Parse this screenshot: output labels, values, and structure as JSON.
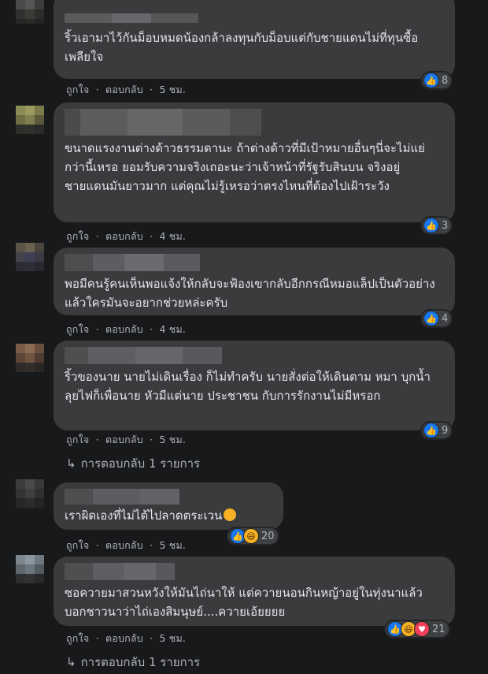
{
  "comments": [
    {
      "text": "ริ้วเอามาไว้กันม็อบหมดน้องกล้าลงทุนกับม็อบแต่กับชายแดนไม่ที่ทุนซื้อ เพลียใจ",
      "like_label": "ถูกใจ",
      "reply_label": "ตอบกลับ",
      "sep": "·",
      "time": "5 ชม.",
      "reactions": [
        "like"
      ],
      "reaction_count": "8"
    },
    {
      "text": "ขนาดแรงงานต่างด้าวธรรมดานะ ถ้าต่างด้าวที่มีเป้าหมายอื่นๆนี่จะไม่แย่กว่านี้เหรอ ยอมรับความจริงเถอะนะว่าเจ้าหน้าที่รัฐรับสินบน จริงอยู่ชายแดนมันยาวมาก แต่คุณไม่รู้เหรอว่าตรงไหนที่ต้องไปเฝ้าระวัง",
      "like_label": "ถูกใจ",
      "reply_label": "ตอบกลับ",
      "sep": "·",
      "time": "4 ชม.",
      "reactions": [
        "like"
      ],
      "reaction_count": "3"
    },
    {
      "text": "พอมีคนรู้คนเห็นพอแจ้งให้กลับจะฟ้องเขากลับอีกกรณีหมอแล็ปเป็นตัวอย่างแล้วใครมันจะอยากช่วยหล่ะครับ",
      "like_label": "ถูกใจ",
      "reply_label": "ตอบกลับ",
      "sep": "·",
      "time": "4 ชม.",
      "reactions": [
        "like"
      ],
      "reaction_count": "4"
    },
    {
      "text": "ริ้วของนาย นายไม่เดินเรื่อง ก็ไม่ทำครับ นายสั่งต่อให้เดินตาม หมา บุกน้ำลุยไฟก็เพื่อนาย หัวมีแต่นาย ประชาชน กับการรักงานไม่มีหรอก",
      "like_label": "ถูกใจ",
      "reply_label": "ตอบกลับ",
      "sep": "·",
      "time": "5 ชม.",
      "reactions": [
        "like"
      ],
      "reaction_count": "9",
      "replies_label": "การตอบกลับ 1 รายการ"
    },
    {
      "text": "เราผิดเองที่ไม่ได้ไปลาดตระเวน",
      "like_label": "ถูกใจ",
      "reply_label": "ตอบกลับ",
      "sep": "·",
      "time": "5 ชม.",
      "reactions": [
        "like",
        "haha"
      ],
      "reaction_count": "20"
    },
    {
      "text": "ซอควายมาสวนหวังให้มันไถ่นาให้ แต่ควายนอนกินหญ้าอยู่ในทุ่งนาแล้วบอกชาวนาว่าไถ่เองสิมนุษย์....ควายเอ้ยยยย",
      "like_label": "ถูกใจ",
      "reply_label": "ตอบกลับ",
      "sep": "·",
      "time": "5 ชม.",
      "reactions": [
        "like",
        "haha",
        "love"
      ],
      "reaction_count": "21",
      "replies_label": "การตอบกลับ 1 รายการ"
    }
  ],
  "icons": {
    "like": "thumbs-up-icon",
    "haha": "laughing-face-icon",
    "love": "heart-icon",
    "reply_arrow": "reply-arrow-icon"
  },
  "colors": {
    "background": "#18191a",
    "bubble": "#3a3b3c",
    "like": "#1877f2",
    "haha": "#f7b125",
    "love": "#f33e58",
    "muted": "#b0b3b8"
  }
}
